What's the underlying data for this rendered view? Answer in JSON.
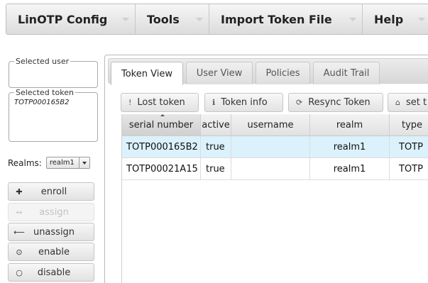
{
  "menu": {
    "items": [
      {
        "label": "LinOTP Config"
      },
      {
        "label": "Tools"
      },
      {
        "label": "Import Token File"
      },
      {
        "label": "Help"
      }
    ]
  },
  "sidebar": {
    "selected_user_legend": "Selected user",
    "selected_user_value": "",
    "selected_token_legend": "Selected token",
    "selected_token_value": "TOTP000165B2",
    "realms_label": "Realms:",
    "realm_selected": "realm1",
    "buttons": [
      {
        "label": "enroll",
        "icon": "plus-icon",
        "glyph": "✚",
        "enabled": true
      },
      {
        "label": "assign",
        "icon": "link-icon",
        "glyph": "↔",
        "enabled": false
      },
      {
        "label": "unassign",
        "icon": "arrow-left-icon",
        "glyph": "⟵",
        "enabled": true
      },
      {
        "label": "enable",
        "icon": "circle-dot-icon",
        "glyph": "⊙",
        "enabled": true
      },
      {
        "label": "disable",
        "icon": "circle-icon",
        "glyph": "○",
        "enabled": true
      }
    ]
  },
  "tabs": [
    {
      "label": "Token View",
      "active": true
    },
    {
      "label": "User View",
      "active": false
    },
    {
      "label": "Policies",
      "active": false
    },
    {
      "label": "Audit Trail",
      "active": false
    }
  ],
  "toolbar": {
    "buttons": [
      {
        "label": "Lost token",
        "icon": "exclamation-icon",
        "glyph": "!"
      },
      {
        "label": "Token info",
        "icon": "info-icon",
        "glyph": "ℹ"
      },
      {
        "label": "Resync Token",
        "icon": "refresh-icon",
        "glyph": "⟳"
      },
      {
        "label": "set t",
        "icon": "home-icon",
        "glyph": "⌂"
      }
    ]
  },
  "table": {
    "columns": [
      "serial number",
      "active",
      "username",
      "realm",
      "type"
    ],
    "rows": [
      [
        "TOTP000165B2",
        "true",
        "",
        "realm1",
        "TOTP"
      ],
      [
        "TOTP00021A15",
        "true",
        "",
        "realm1",
        "TOTP"
      ]
    ],
    "selected_row": 0,
    "sorted_column": "serial number"
  },
  "colors": {
    "selected_row_bg": "#dbf1fb"
  }
}
